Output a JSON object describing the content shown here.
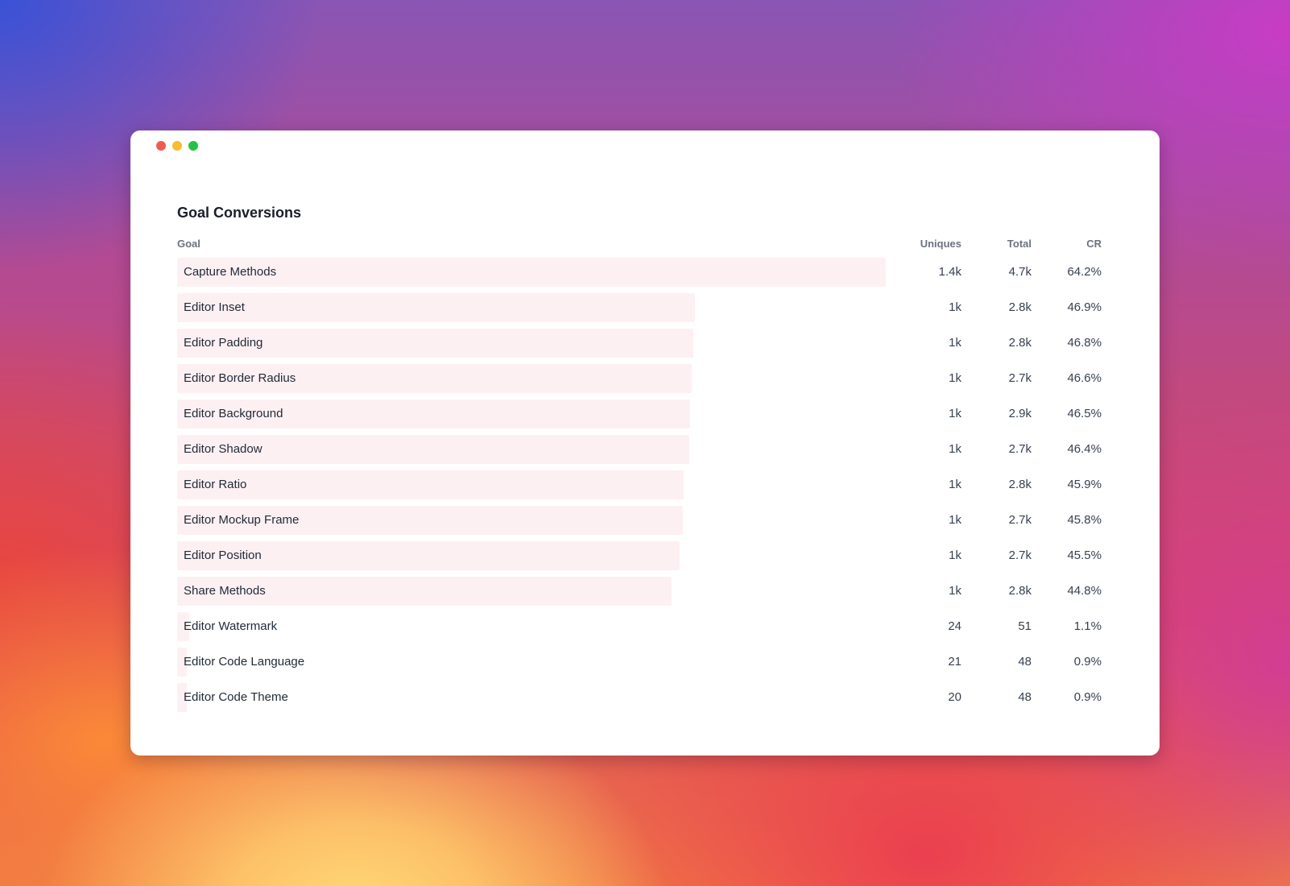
{
  "window": {
    "traffic_lights": [
      {
        "name": "close",
        "color": "#f05a50"
      },
      {
        "name": "minimize",
        "color": "#f6bd31"
      },
      {
        "name": "maximize",
        "color": "#27c244"
      }
    ]
  },
  "panel": {
    "title": "Goal Conversions",
    "columns": {
      "goal": "Goal",
      "uniques": "Uniques",
      "total": "Total",
      "cr": "CR"
    },
    "bar_color": "#fdf0f2",
    "rows": [
      {
        "goal": "Capture Methods",
        "uniques": "1.4k",
        "total": "4.7k",
        "cr": "64.2%",
        "cr_value": 64.2
      },
      {
        "goal": "Editor Inset",
        "uniques": "1k",
        "total": "2.8k",
        "cr": "46.9%",
        "cr_value": 46.9
      },
      {
        "goal": "Editor Padding",
        "uniques": "1k",
        "total": "2.8k",
        "cr": "46.8%",
        "cr_value": 46.8
      },
      {
        "goal": "Editor Border Radius",
        "uniques": "1k",
        "total": "2.7k",
        "cr": "46.6%",
        "cr_value": 46.6
      },
      {
        "goal": "Editor Background",
        "uniques": "1k",
        "total": "2.9k",
        "cr": "46.5%",
        "cr_value": 46.5
      },
      {
        "goal": "Editor Shadow",
        "uniques": "1k",
        "total": "2.7k",
        "cr": "46.4%",
        "cr_value": 46.4
      },
      {
        "goal": "Editor Ratio",
        "uniques": "1k",
        "total": "2.8k",
        "cr": "45.9%",
        "cr_value": 45.9
      },
      {
        "goal": "Editor Mockup Frame",
        "uniques": "1k",
        "total": "2.7k",
        "cr": "45.8%",
        "cr_value": 45.8
      },
      {
        "goal": "Editor Position",
        "uniques": "1k",
        "total": "2.7k",
        "cr": "45.5%",
        "cr_value": 45.5
      },
      {
        "goal": "Share Methods",
        "uniques": "1k",
        "total": "2.8k",
        "cr": "44.8%",
        "cr_value": 44.8
      },
      {
        "goal": "Editor Watermark",
        "uniques": "24",
        "total": "51",
        "cr": "1.1%",
        "cr_value": 1.1
      },
      {
        "goal": "Editor Code Language",
        "uniques": "21",
        "total": "48",
        "cr": "0.9%",
        "cr_value": 0.9
      },
      {
        "goal": "Editor Code Theme",
        "uniques": "20",
        "total": "48",
        "cr": "0.9%",
        "cr_value": 0.9
      }
    ]
  }
}
